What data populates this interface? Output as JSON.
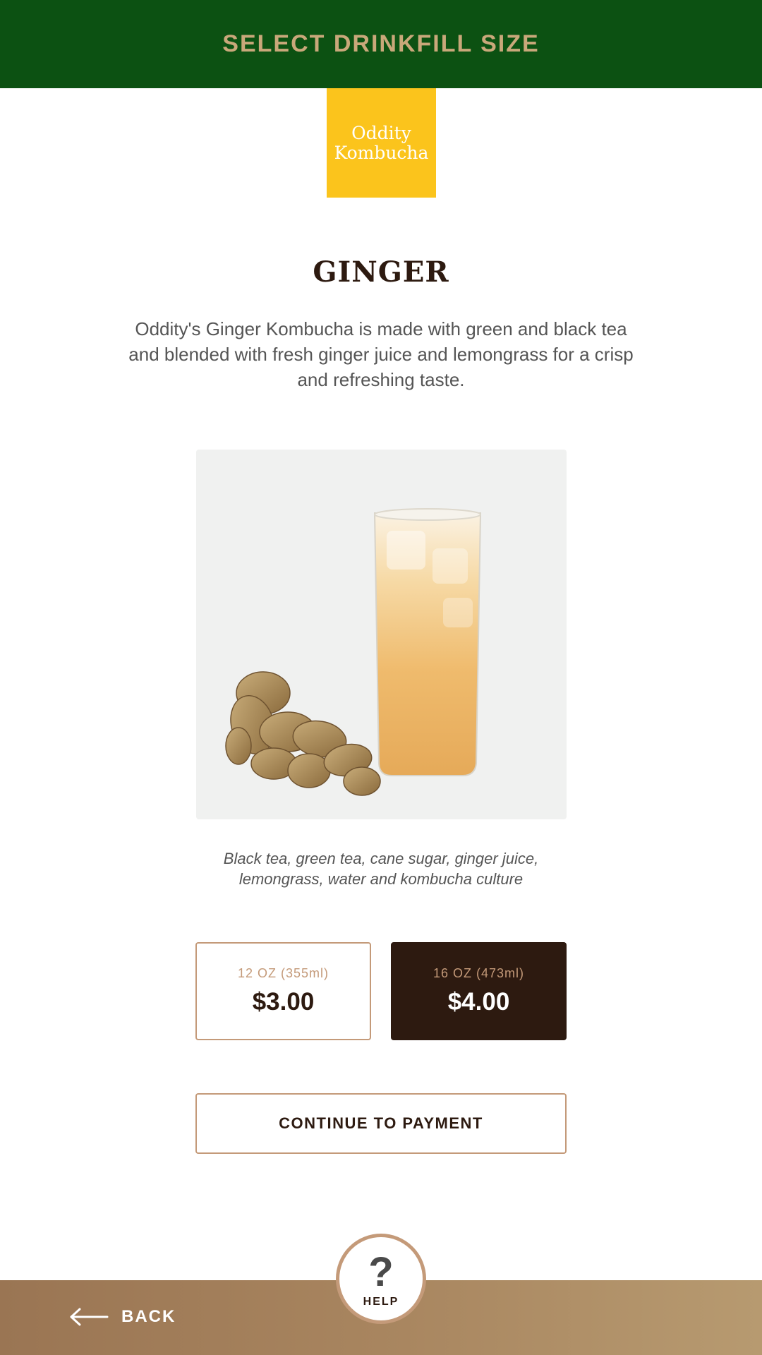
{
  "header": {
    "title": "SELECT DRINKFILL SIZE"
  },
  "logo": {
    "line1": "Oddity",
    "line2": "Kombucha"
  },
  "product": {
    "name": "GINGER",
    "description": "Oddity's Ginger Kombucha is made with green and black tea and blended with fresh ginger juice and lemongrass for a crisp and refreshing taste.",
    "ingredients_line1": "Black tea, green tea, cane sugar, ginger juice,",
    "ingredients_line2": "lemongrass, water and kombucha culture"
  },
  "sizes": [
    {
      "label": "12 OZ (355ml)",
      "price": "$3.00",
      "selected": false
    },
    {
      "label": "16 OZ (473ml)",
      "price": "$4.00",
      "selected": true
    }
  ],
  "actions": {
    "continue_label": "CONTINUE TO PAYMENT",
    "back_label": "BACK",
    "help_label": "HELP",
    "help_glyph": "?"
  },
  "icons": {
    "back": "arrow-left-icon",
    "help": "question-mark-icon"
  },
  "colors": {
    "header_bg": "#0c5112",
    "header_text": "#c9a87a",
    "logo_bg": "#fbc41c",
    "dark_brown": "#2d1a10",
    "accent_tan": "#c49a79",
    "footer_tan": "#a8855f"
  }
}
